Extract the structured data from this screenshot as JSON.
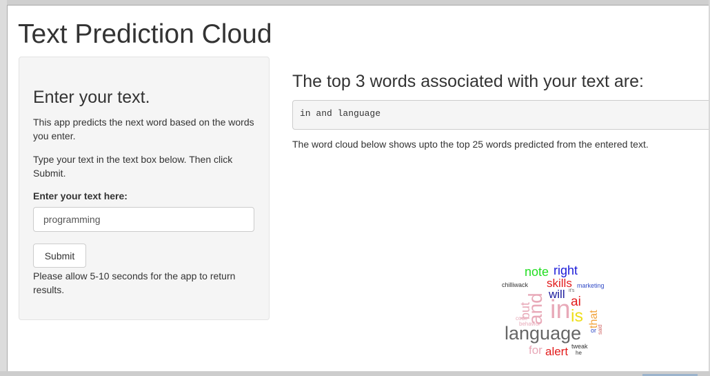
{
  "app": {
    "title": "Text Prediction Cloud"
  },
  "sidebar": {
    "heading": "Enter your text.",
    "description": "This app predicts the next word based on the words you enter.",
    "instruction": "Type your text in the text box below. Then click Submit.",
    "input_label": "Enter your text here:",
    "input_value": "programming",
    "submit_label": "Submit",
    "note": "Please allow 5-10 seconds for the app to return results."
  },
  "main": {
    "heading": "The top 3 words associated with your text are:",
    "result": "in and language",
    "description": "The word cloud below shows upto the top 25 words predicted from the entered text."
  },
  "word_cloud": [
    {
      "word": "note",
      "color": "#22dd22"
    },
    {
      "word": "right",
      "color": "#1a1ad8"
    },
    {
      "word": "skills",
      "color": "#e21b1b"
    },
    {
      "word": "marketing",
      "color": "#2f49c6"
    },
    {
      "word": "chilliwack",
      "color": "#333333"
    },
    {
      "word": "it's",
      "color": "#666666"
    },
    {
      "word": "will",
      "color": "#1a1a9c"
    },
    {
      "word": "ai",
      "color": "#e21b1b"
    },
    {
      "word": "and",
      "color": "#e8a9b8"
    },
    {
      "word": "but",
      "color": "#e8a9b8"
    },
    {
      "word": "in",
      "color": "#e8a9b8"
    },
    {
      "word": "is",
      "color": "#eede1a"
    },
    {
      "word": "that",
      "color": "#f2a33a"
    },
    {
      "word": "code",
      "color": "#e8a9b8"
    },
    {
      "word": "behavior",
      "color": "#e8a9b8"
    },
    {
      "word": "or",
      "color": "#2f49c6"
    },
    {
      "word": "said",
      "color": "#d16a6a"
    },
    {
      "word": "language",
      "color": "#666666"
    },
    {
      "word": "tweak",
      "color": "#333333"
    },
    {
      "word": "for",
      "color": "#e8a9b8"
    },
    {
      "word": "alert",
      "color": "#e21b1b"
    },
    {
      "word": "he",
      "color": "#333333"
    }
  ]
}
